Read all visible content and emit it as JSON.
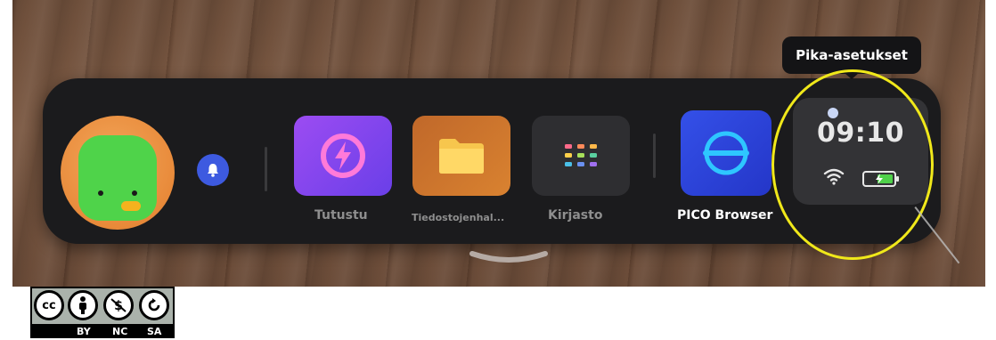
{
  "tooltip": {
    "text": "Pika-asetukset"
  },
  "apps": [
    {
      "label": "Tutustu",
      "icon": "lightning-icon",
      "color": "#7d4cf0"
    },
    {
      "label": "Tiedostojenhal...",
      "icon": "folder-icon",
      "color": "#d0742d"
    },
    {
      "label": "Kirjasto",
      "icon": "grid-icon",
      "color": "#2e2e31"
    },
    {
      "label": "PICO Browser",
      "icon": "browser-icon",
      "color": "#2c3fdc"
    }
  ],
  "quick_settings": {
    "time": "09:10",
    "wifi_icon": "wifi-icon",
    "battery_icon": "battery-charging-icon"
  },
  "license": {
    "symbol": "cc",
    "tags": [
      "BY",
      "NC",
      "SA"
    ]
  },
  "colors": {
    "highlight": "#f0e81a",
    "notification": "#3d5ae0",
    "dock": "#1b1b1d"
  }
}
